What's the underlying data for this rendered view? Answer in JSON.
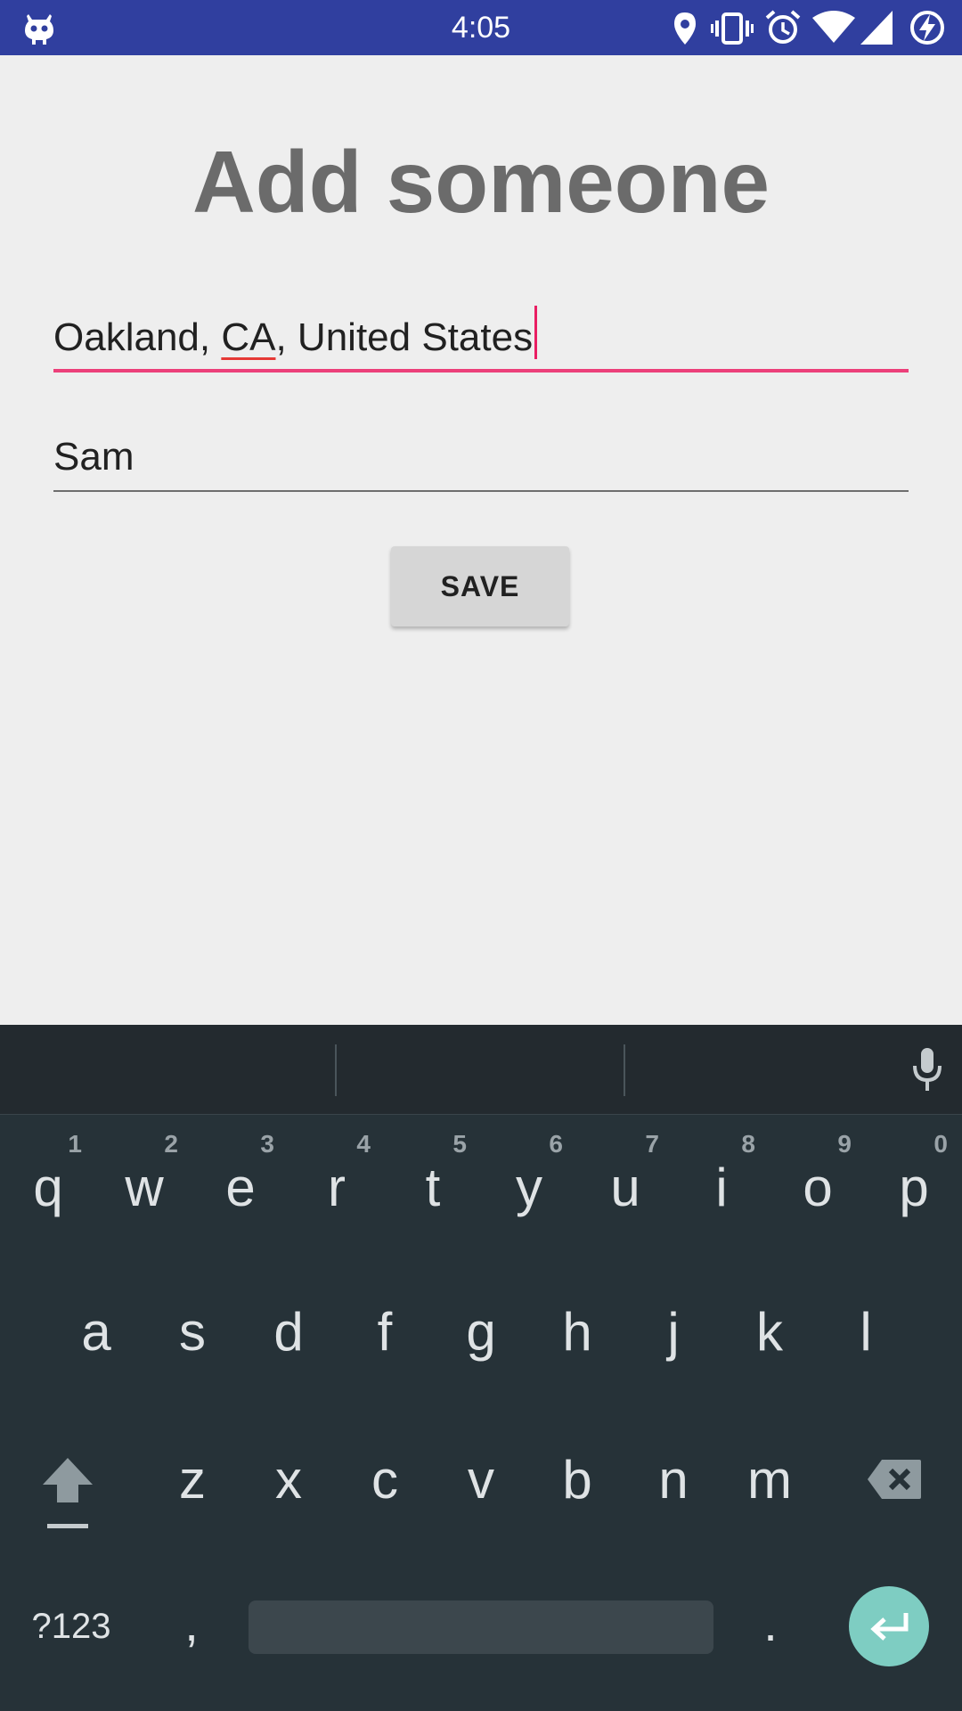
{
  "status_bar": {
    "time": "4:05",
    "icons": [
      "cyanogenmod-icon",
      "location-icon",
      "vibrate-icon",
      "alarm-icon",
      "wifi-icon",
      "signal-icon",
      "battery-charging-icon"
    ],
    "background": "#303f9f"
  },
  "main": {
    "title": "Add someone",
    "location_field": {
      "value_before": "Oakland, ",
      "value_misspelled": "CA",
      "value_after": ", United States",
      "focused": true,
      "accent_color": "#ec407a"
    },
    "name_field": {
      "value": "Sam"
    },
    "save_label": "SAVE"
  },
  "keyboard": {
    "row1": [
      {
        "letter": "q",
        "hint": "1"
      },
      {
        "letter": "w",
        "hint": "2"
      },
      {
        "letter": "e",
        "hint": "3"
      },
      {
        "letter": "r",
        "hint": "4"
      },
      {
        "letter": "t",
        "hint": "5"
      },
      {
        "letter": "y",
        "hint": "6"
      },
      {
        "letter": "u",
        "hint": "7"
      },
      {
        "letter": "i",
        "hint": "8"
      },
      {
        "letter": "o",
        "hint": "9"
      },
      {
        "letter": "p",
        "hint": "0"
      }
    ],
    "row2": [
      "a",
      "s",
      "d",
      "f",
      "g",
      "h",
      "j",
      "k",
      "l"
    ],
    "row3": [
      "z",
      "x",
      "c",
      "v",
      "b",
      "n",
      "m"
    ],
    "symbols_label": "?123",
    "comma_label": ",",
    "period_label": ".",
    "icons": [
      "shift-icon",
      "backspace-icon",
      "microphone-icon",
      "enter-icon"
    ],
    "enter_color": "#7ecdc2"
  }
}
